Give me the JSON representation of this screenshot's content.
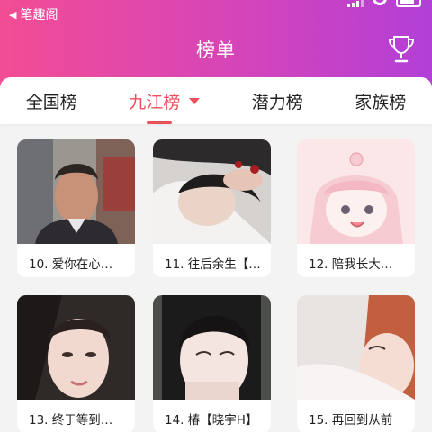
{
  "status": {
    "back_app": "笔趣阁"
  },
  "header": {
    "title": "榜单",
    "icon": "trophy-icon"
  },
  "tabs": [
    {
      "label": "全国榜",
      "active": false
    },
    {
      "label": "九江榜",
      "active": true
    },
    {
      "label": "潜力榜",
      "active": false
    },
    {
      "label": "家族榜",
      "active": false
    }
  ],
  "cards": [
    {
      "caption": "10. 爱你在心…"
    },
    {
      "caption": "11. 往后余生【…"
    },
    {
      "caption": "12. 陪我长大…"
    },
    {
      "caption": "13. 终于等到…"
    },
    {
      "caption": "14. 椿【晓宇H】"
    },
    {
      "caption": "15. 再回到从前"
    }
  ],
  "colors": {
    "accent": "#ec4f5a",
    "gradient_start": "#f24d94",
    "gradient_end": "#b23fd6"
  }
}
